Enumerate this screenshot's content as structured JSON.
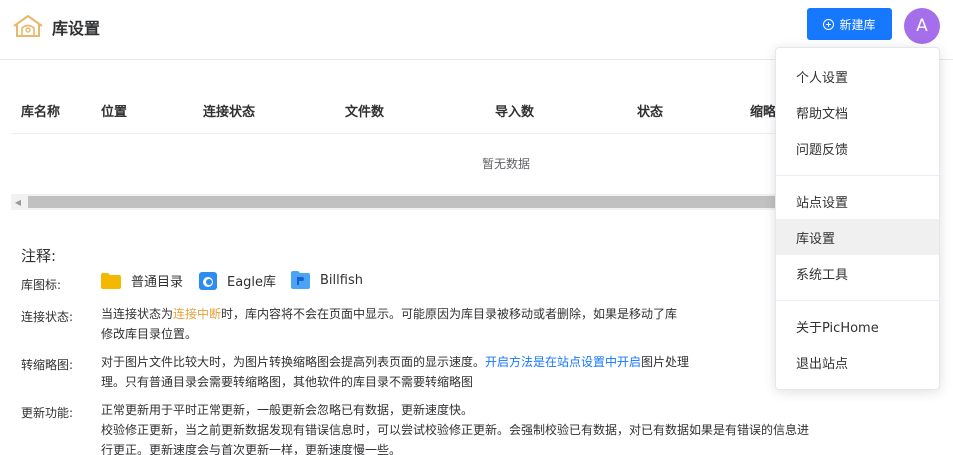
{
  "header": {
    "title": "库设置",
    "new_lib_label": "新建库",
    "avatar_letter": "A"
  },
  "table": {
    "columns": [
      "库名称",
      "位置",
      "连接状态",
      "文件数",
      "导入数",
      "状态",
      "缩略"
    ],
    "empty_text": "暂无数据"
  },
  "notes": {
    "title": "注释:",
    "icon_label": "库图标:",
    "icon_types": [
      "普通目录",
      "Eagle库",
      "Billfish"
    ],
    "connection_label": "连接状态:",
    "connection_prefix": "当连接状态为",
    "connection_link": "连接中断",
    "connection_suffix": "时，库内容将不会在页面中显示。可能原因为库目录被移动或者删除，如果是移动了库",
    "connection_line2": "修改库目录位置。",
    "thumb_label": "转缩略图:",
    "thumb_prefix": "对于图片文件比较大时，为图片转换缩略图会提高列表页面的显示速度。",
    "thumb_link": "开启方法是在站点设置中开启",
    "thumb_suffix": "图片处理",
    "thumb_line2": "理。只有普通目录会需要转缩略图，其他软件的库目录不需要转缩略图",
    "update_label": "更新功能:",
    "update_line1": "正常更新用于平时正常更新，一般更新会忽略已有数据，更新速度快。",
    "update_line2": "校验修正更新，当之前更新数据发现有错误信息时，可以尝试校验修正更新。会强制校验已有数据，对已有数据如果是有错误的信息进",
    "update_line3": "行更正。更新速度会与首次更新一样，更新速度慢一些。"
  },
  "menu": {
    "items": [
      "个人设置",
      "帮助文档",
      "问题反馈",
      "站点设置",
      "库设置",
      "系统工具",
      "关于PicHome",
      "退出站点"
    ],
    "active": "库设置"
  },
  "colors": {
    "primary": "#1677ff",
    "avatar": "#a56eea",
    "warning": "#e6a23c",
    "logo": "#e8b86b"
  }
}
